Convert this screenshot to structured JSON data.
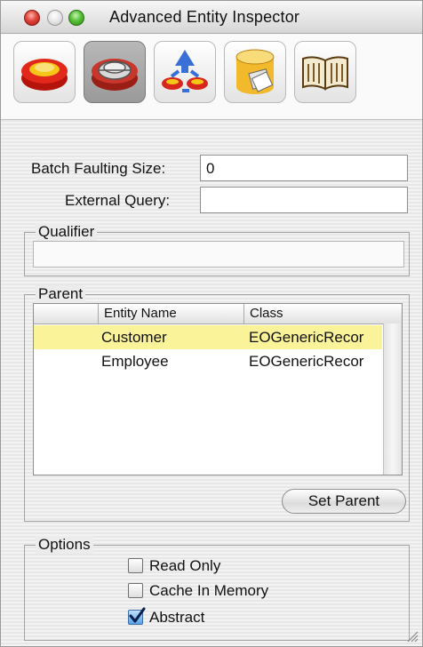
{
  "window": {
    "title": "Advanced Entity Inspector"
  },
  "toolbar": {
    "buttons": [
      {
        "icon": "entity-inspector-icon"
      },
      {
        "icon": "advanced-entity-inspector-icon",
        "selected": true
      },
      {
        "icon": "stored-procedure-icon"
      },
      {
        "icon": "database-icon"
      },
      {
        "icon": "documentation-book-icon"
      }
    ]
  },
  "batch_faulting": {
    "label": "Batch Faulting Size:",
    "value": "0"
  },
  "external_query": {
    "label": "External Query:",
    "value": ""
  },
  "qualifier": {
    "title": "Qualifier",
    "value": ""
  },
  "parent": {
    "title": "Parent",
    "columns": [
      "Entity Name",
      "Class"
    ],
    "rows": [
      {
        "entity_name": "Customer",
        "class": "EOGenericRecor",
        "selected": true
      },
      {
        "entity_name": "Employee",
        "class": "EOGenericRecor",
        "selected": false
      }
    ],
    "set_parent_label": "Set Parent"
  },
  "options": {
    "title": "Options",
    "items": [
      {
        "label": "Read Only",
        "checked": false
      },
      {
        "label": "Cache In Memory",
        "checked": false
      },
      {
        "label": "Abstract",
        "checked": true
      }
    ]
  },
  "colors": {
    "selection": "#fbf39a",
    "accent": "#5aa3e8"
  }
}
